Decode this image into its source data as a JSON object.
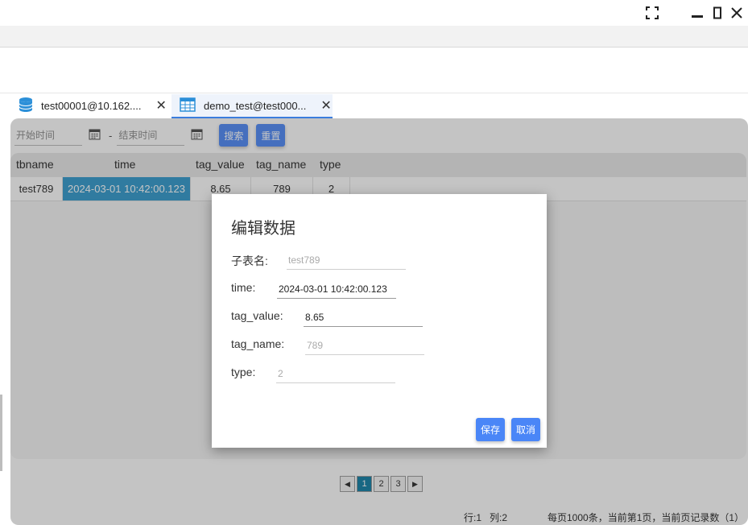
{
  "window": {
    "fullscreen_icon": "fullscreen-icon",
    "minimize_icon": "minimize-icon",
    "maximize_icon": "maximize-icon",
    "close_icon": "close-icon"
  },
  "tabs": [
    {
      "label": "test00001@10.162....",
      "icon": "database-icon",
      "close": "✕"
    },
    {
      "label": "demo_test@test000...",
      "icon": "table-icon",
      "close": "✕"
    }
  ],
  "filters": {
    "start_placeholder": "开始时间",
    "separator": "-",
    "end_placeholder": "结束时间",
    "search_label": "搜索",
    "reset_label": "重置"
  },
  "table": {
    "columns": [
      "tbname",
      "time",
      "tag_value",
      "tag_name",
      "type"
    ],
    "rows": [
      [
        "test789",
        "2024-03-01 10:42:00.123",
        "8.65",
        "789",
        "2"
      ]
    ]
  },
  "pager": {
    "prev": "◀",
    "pages": [
      "1",
      "2",
      "3"
    ],
    "next": "▶"
  },
  "status": {
    "row_col": "行:1   列:2",
    "info": "每页1000条，当前第1页，当前页记录数（1）"
  },
  "dialog": {
    "title": "编辑数据",
    "fields": [
      {
        "label": "子表名:",
        "value": "test789"
      },
      {
        "label": "time:",
        "value": "2024-03-01 10:42:00.123"
      },
      {
        "label": "tag_value:",
        "value": "8.65"
      },
      {
        "label": "tag_name:",
        "value": "789"
      },
      {
        "label": "type:",
        "value": "2"
      }
    ],
    "save_label": "保存",
    "cancel_label": "取消"
  },
  "colors": {
    "accent": "#4a86f7",
    "selected_cell": "#2b97cc",
    "current_page": "#0a7aa3"
  }
}
